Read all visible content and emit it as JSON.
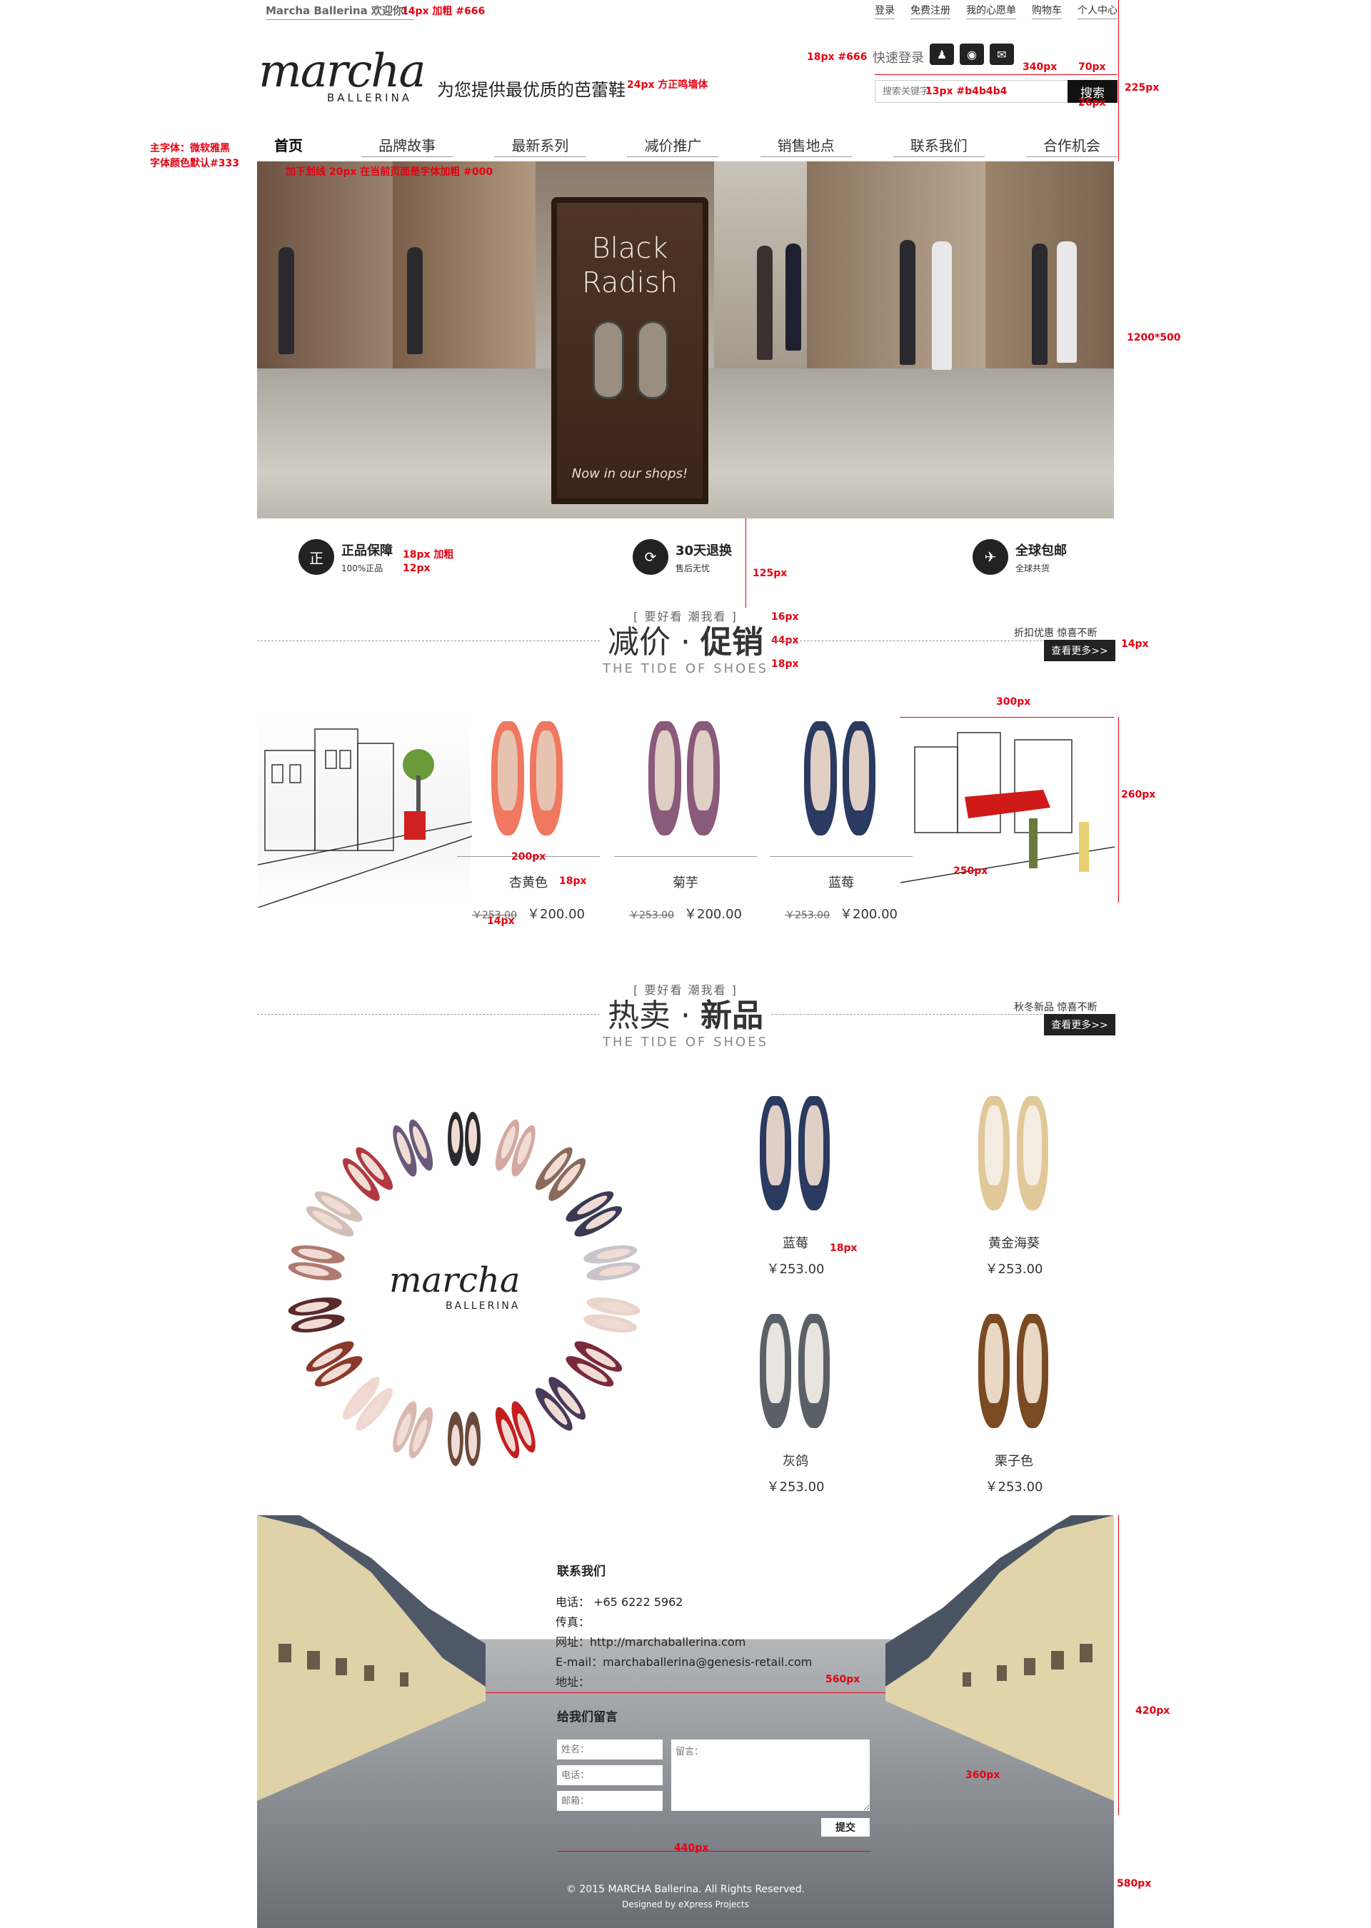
{
  "topbar": {
    "welcome": "Marcha Ballerina 欢迎你！",
    "links": [
      "登录",
      "免费注册",
      "我的心愿单",
      "购物车",
      "个人中心"
    ]
  },
  "header": {
    "logo_main": "marcha",
    "logo_sub": "BALLERINA",
    "slogan": "为您提供最优质的芭蕾鞋",
    "quick_login": "快速登录",
    "social_icons": [
      "qq-icon",
      "weibo-icon",
      "wechat-icon"
    ],
    "search_placeholder": "搜索关键字",
    "search_button": "搜索"
  },
  "nav": [
    "首页",
    "品牌故事",
    "最新系列",
    "减价推广",
    "销售地点",
    "联系我们",
    "合作机会"
  ],
  "banner": {
    "sign_line1": "Black",
    "sign_line2": "Radish",
    "sign_bottom": "Now in our shops!"
  },
  "features": [
    {
      "icon": "正",
      "title": "正品保障",
      "desc": "100%正品"
    },
    {
      "icon": "⟳",
      "title": "30天退换",
      "desc": "售后无忧"
    },
    {
      "icon": "✈",
      "title": "全球包邮",
      "desc": "全球共货"
    }
  ],
  "sale": {
    "sub": "[ 要好看 潮我看 ]",
    "title_a": "减价",
    "title_b": "促销",
    "en": "THE TIDE OF SHOES",
    "note": "折扣优惠  惊喜不断",
    "more": "查看更多>>",
    "products": [
      {
        "name": "杏黄色",
        "old": "￥253.00",
        "price": "￥200.00",
        "color": "#f07860"
      },
      {
        "name": "菊芋",
        "old": "￥253.00",
        "price": "￥200.00",
        "color": "#8a5a7a"
      },
      {
        "name": "蓝莓",
        "old": "￥253.00",
        "price": "￥200.00",
        "color": "#2a3a60"
      }
    ]
  },
  "hot": {
    "sub": "[ 要好看 潮我看 ]",
    "title_a": "热卖",
    "title_b": "新品",
    "en": "THE TIDE OF SHOES",
    "note": "秋冬新品  惊喜不断",
    "more": "查看更多>>",
    "circle_logo": "marcha",
    "circle_sub": "BALLERINA",
    "products": [
      {
        "name": "蓝莓",
        "price": "￥253.00",
        "color": "#2a3a60"
      },
      {
        "name": "黄金海葵",
        "price": "￥253.00",
        "color": "#e0c898"
      },
      {
        "name": "灰鸽",
        "price": "￥253.00",
        "color": "#5a6068"
      },
      {
        "name": "栗子色",
        "price": "￥253.00",
        "color": "#7a4a22"
      }
    ]
  },
  "footer": {
    "contact_title": "联系我们",
    "phone": "电话： +65 6222 5962",
    "fax": "传真：",
    "url": "网址：http://marchaballerina.com",
    "email": "E-mail：marchaballerina@genesis-retail.com",
    "address": "地址：",
    "msg_title": "给我们留言",
    "name_ph": "姓名：",
    "tel_ph": "电话：",
    "mail_ph": "邮箱：",
    "msg_ph": "留言：",
    "submit": "提交",
    "copyright": "© 2015 MARCHA Ballerina. All Rights Reserved.",
    "designed": "Designed by eXpress Projects"
  },
  "annotations": {
    "a_top": "14px 加粗 #666",
    "a_quick": "18px  #666",
    "a_340": "340px",
    "a_70": "70px",
    "a_225": "225px",
    "a_slogan": "24px 方正鸣墙体",
    "a_search": "13px  #b4b4b4",
    "a_26": "26px",
    "a_font": "主字体：微软雅黑",
    "a_color": "字体颜色默认#333",
    "a_nav": "加下划线 20px 在当前页面是字体加粗 #000",
    "a_1200": "1200*500",
    "a_feat1": "18px 加粗",
    "a_feat2": "12px",
    "a_125": "125px",
    "a_16": "16px",
    "a_44": "44px",
    "a_18": "18px",
    "a_14": "14px",
    "a_300": "300px",
    "a_260": "260px",
    "a_200": "200px",
    "a_250": "250px",
    "a_18b": "18px",
    "a_14b": "14px",
    "a_18c": "18px",
    "a_560": "560px",
    "a_420": "420px",
    "a_360": "360px",
    "a_440": "440px",
    "a_580": "580px"
  },
  "colors": {
    "accent": "#e60012",
    "text": "#333333",
    "dark": "#222222"
  }
}
